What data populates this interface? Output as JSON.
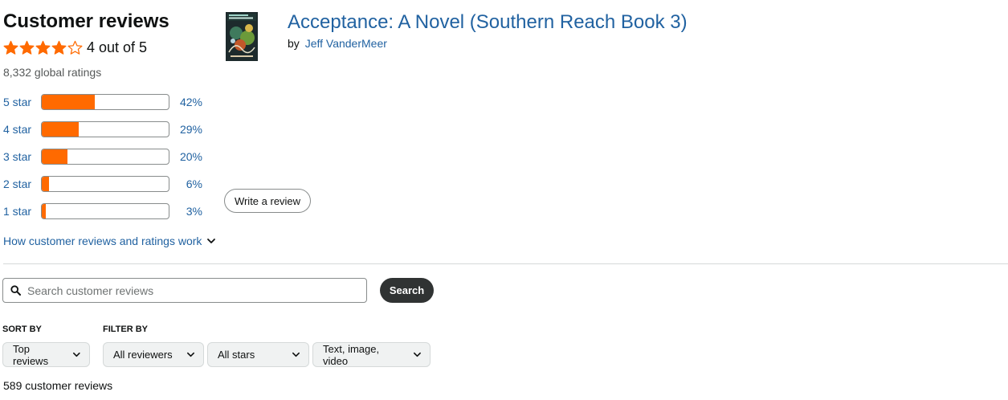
{
  "summary": {
    "heading": "Customer reviews",
    "rating_value": 4,
    "rating_max": 5,
    "rating_text": "4 out of 5",
    "global_ratings": "8,332 global ratings",
    "star_color": "#ff6a00"
  },
  "histogram": [
    {
      "label": "5 star",
      "percent_text": "42%",
      "percent": 42
    },
    {
      "label": "4 star",
      "percent_text": "29%",
      "percent": 29
    },
    {
      "label": "3 star",
      "percent_text": "20%",
      "percent": 20
    },
    {
      "label": "2 star",
      "percent_text": "6%",
      "percent": 6
    },
    {
      "label": "1 star",
      "percent_text": "3%",
      "percent": 3
    }
  ],
  "how_link": "How customer reviews and ratings work",
  "product": {
    "title": "Acceptance: A Novel (Southern Reach Book 3)",
    "by_prefix": "by",
    "author": "Jeff VanderMeer"
  },
  "write_review_label": "Write a review",
  "search": {
    "placeholder": "Search customer reviews",
    "value": "",
    "button_label": "Search"
  },
  "sort": {
    "label": "SORT BY",
    "selected": "Top reviews"
  },
  "filter": {
    "label": "FILTER BY",
    "reviewers": "All reviewers",
    "stars": "All stars",
    "media": "Text, image, video"
  },
  "review_count": "589 customer reviews",
  "colors": {
    "link": "#2162a1",
    "bar_fill": "#ff6a00",
    "search_button": "#303333"
  }
}
